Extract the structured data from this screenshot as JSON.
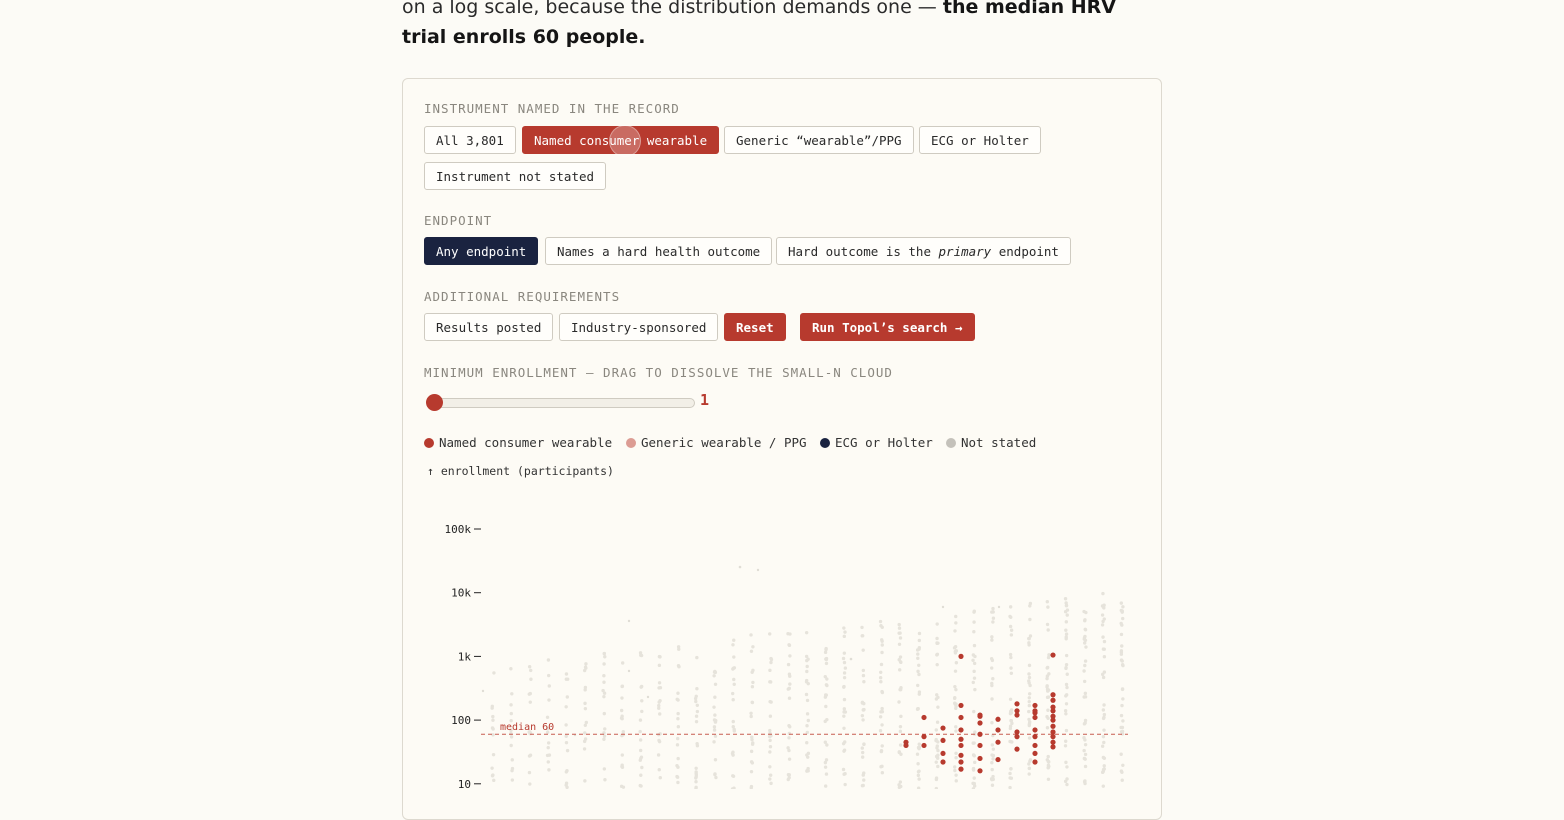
{
  "intro": {
    "text": "on a log scale, because the distribution demands one — ",
    "bold": "the median HRV trial enrolls 60 people."
  },
  "instrument": {
    "label": "INSTRUMENT NAMED IN THE RECORD",
    "options": [
      "All 3,801",
      "Named consumer wearable",
      "Generic “wearable”/PPG",
      "ECG or Holter",
      "Instrument not stated"
    ],
    "selected": "Named consumer wearable"
  },
  "endpoint": {
    "label": "ENDPOINT",
    "options": [
      "Any endpoint",
      "Names a hard health outcome",
      "Hard outcome is the",
      "primary",
      "endpoint"
    ],
    "selected": "Any endpoint"
  },
  "additional": {
    "label": "ADDITIONAL REQUIREMENTS",
    "results_posted": "Results posted",
    "industry": "Industry-sponsored",
    "reset": "Reset",
    "run": "Run Topol’s search →"
  },
  "slider": {
    "label": "MINIMUM ENROLLMENT — DRAG TO DISSOLVE THE SMALL-N CLOUD",
    "value": "1"
  },
  "legend": [
    {
      "label": "Named consumer wearable",
      "color": "#b73a2e"
    },
    {
      "label": "Generic wearable / PPG",
      "color": "#dc9c93"
    },
    {
      "label": "ECG or Holter",
      "color": "#1a2340"
    },
    {
      "label": "Not stated",
      "color": "#c4c1ba"
    }
  ],
  "chart_data": {
    "type": "scatter",
    "ylabel": "↑ enrollment (participants)",
    "yscale": "log",
    "yticks": [
      "100k",
      "10k",
      "1k",
      "100",
      "10"
    ],
    "ytick_values": [
      100000,
      10000,
      1000,
      100,
      10
    ],
    "median_label": "median 60",
    "median_value": 60,
    "highlight_points": [
      [
        0,
        45
      ],
      [
        0,
        40
      ],
      [
        1,
        110
      ],
      [
        1,
        55
      ],
      [
        1,
        40
      ],
      [
        2,
        75
      ],
      [
        2,
        48
      ],
      [
        2,
        30
      ],
      [
        2,
        22
      ],
      [
        3,
        1000
      ],
      [
        3,
        170
      ],
      [
        3,
        110
      ],
      [
        3,
        70
      ],
      [
        3,
        50
      ],
      [
        3,
        40
      ],
      [
        3,
        28
      ],
      [
        3,
        22
      ],
      [
        3,
        17
      ],
      [
        4,
        120
      ],
      [
        4,
        115
      ],
      [
        4,
        90
      ],
      [
        4,
        60
      ],
      [
        4,
        40
      ],
      [
        4,
        25
      ],
      [
        4,
        16
      ],
      [
        5,
        103
      ],
      [
        5,
        70
      ],
      [
        5,
        45
      ],
      [
        5,
        24
      ],
      [
        6,
        180
      ],
      [
        6,
        140
      ],
      [
        6,
        120
      ],
      [
        6,
        65
      ],
      [
        6,
        55
      ],
      [
        6,
        35
      ],
      [
        7,
        140
      ],
      [
        7,
        170
      ],
      [
        7,
        130
      ],
      [
        7,
        110
      ],
      [
        7,
        70
      ],
      [
        7,
        55
      ],
      [
        7,
        40
      ],
      [
        7,
        30
      ],
      [
        7,
        22
      ],
      [
        8,
        1050
      ],
      [
        8,
        250
      ],
      [
        8,
        205
      ],
      [
        8,
        160
      ],
      [
        8,
        140
      ],
      [
        8,
        115
      ],
      [
        8,
        100
      ],
      [
        8,
        80
      ],
      [
        8,
        65
      ],
      [
        8,
        55
      ],
      [
        8,
        45
      ],
      [
        8,
        38
      ]
    ]
  }
}
